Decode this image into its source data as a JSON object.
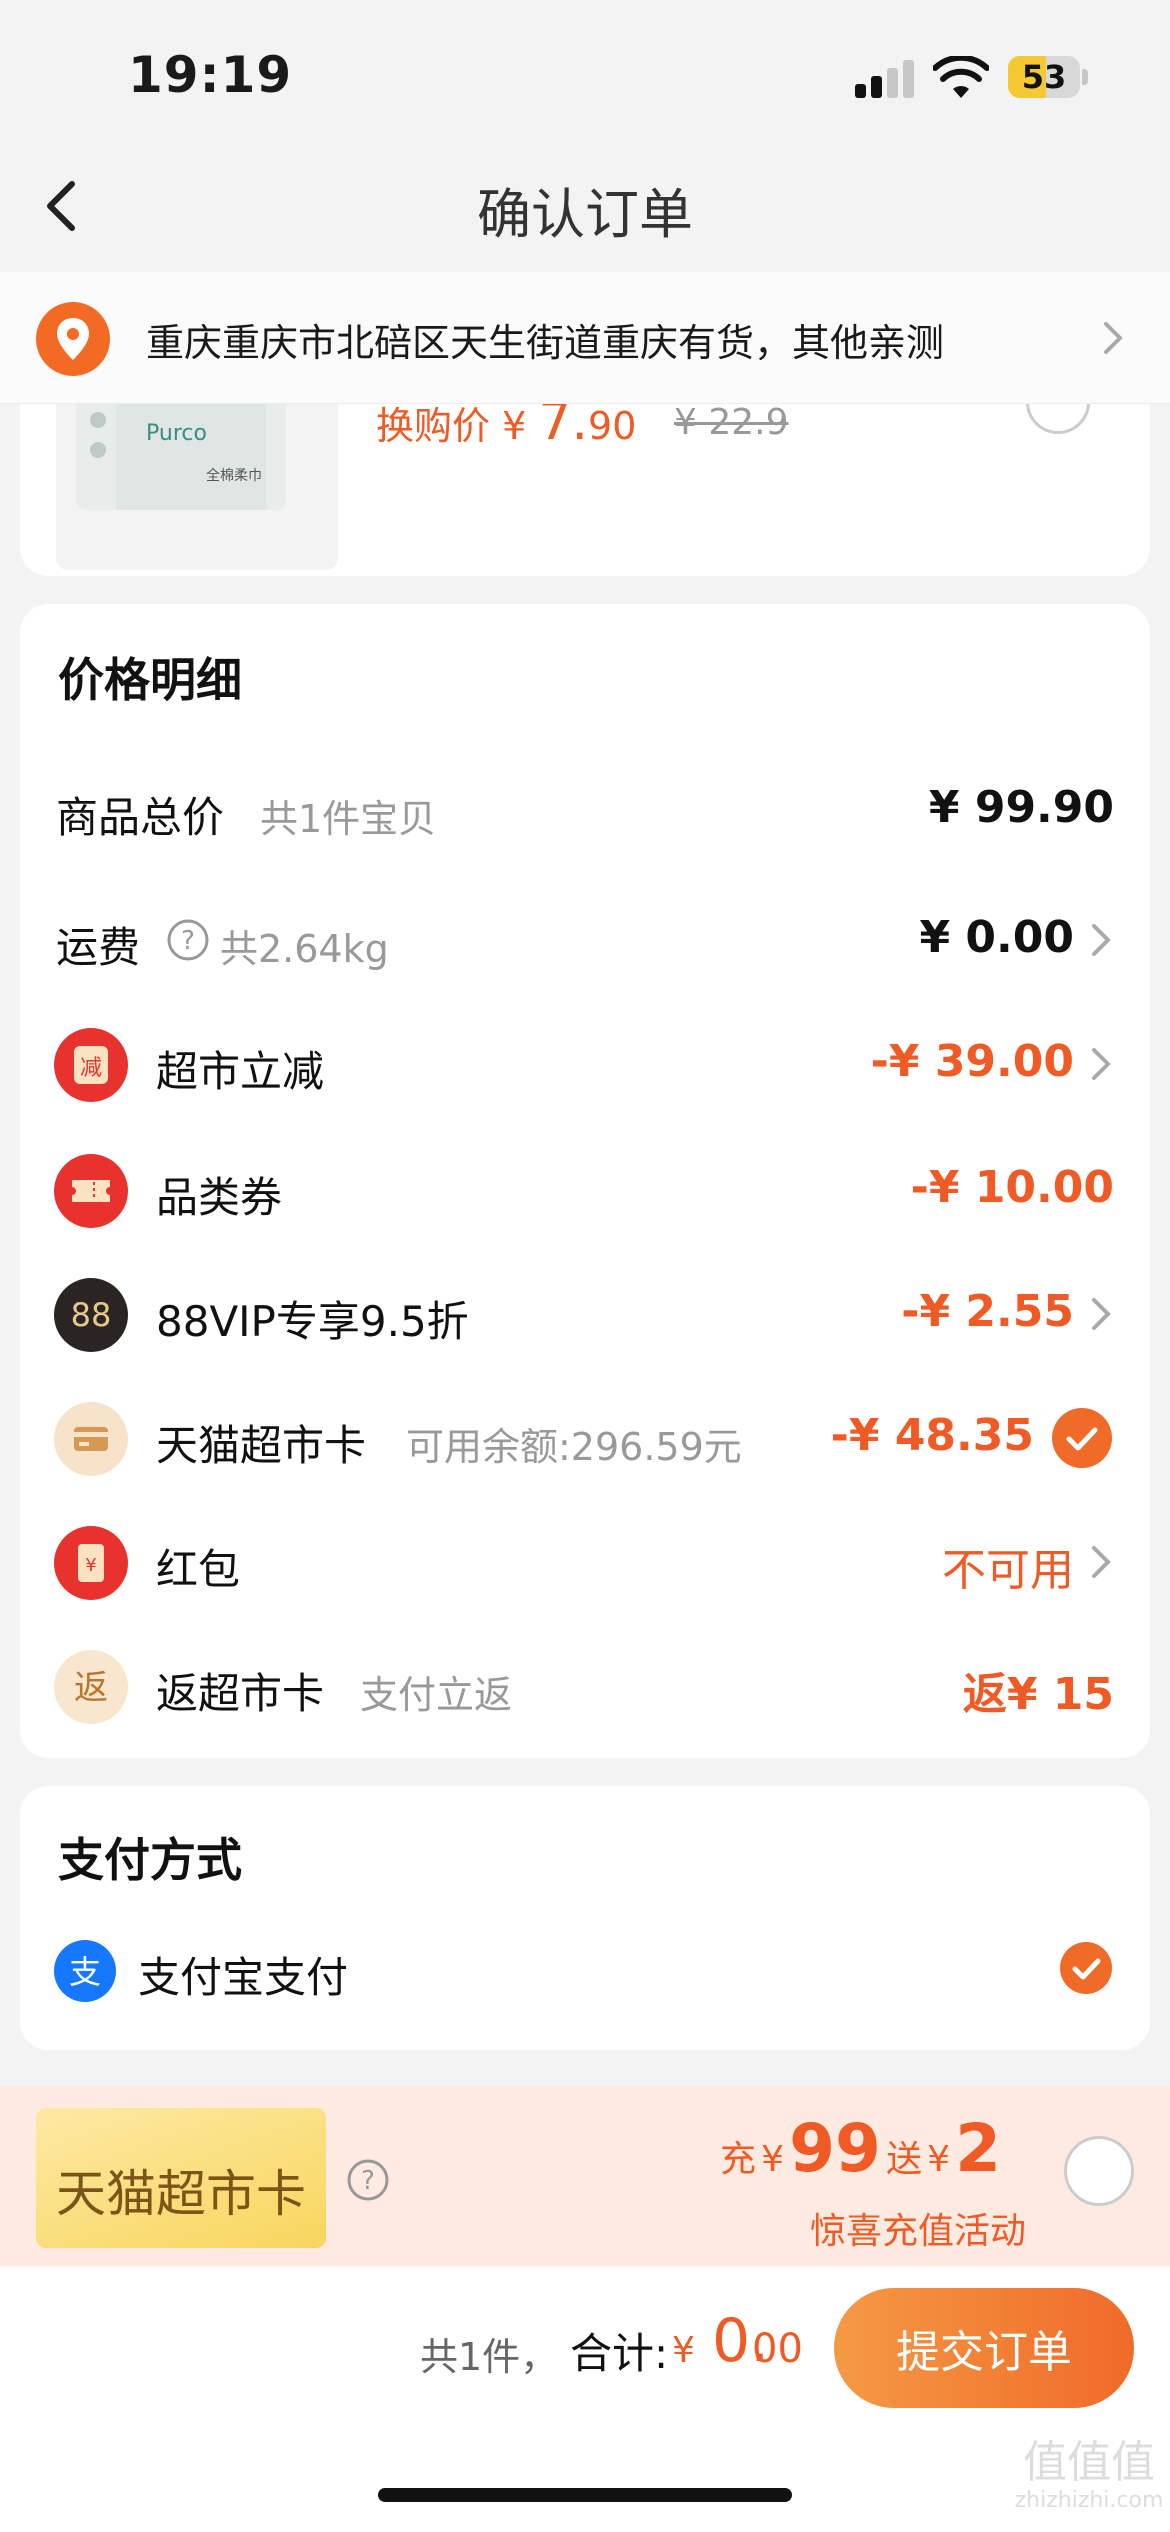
{
  "status_bar": {
    "time": "19:19",
    "battery_level": "53",
    "battery_fraction": 0.53
  },
  "header": {
    "title": "确认订单"
  },
  "address": {
    "text": "重庆重庆市北碚区天生街道重庆有货，其他亲测"
  },
  "product": {
    "price_label": "换购价",
    "price_currency": "¥",
    "price_int": "7.",
    "price_dec": "90",
    "original_price": "¥ 22.9",
    "image_text": "全棉柔巾"
  },
  "price_detail": {
    "title": "价格明细",
    "rows": [
      {
        "label": "商品总价",
        "sub": "共1件宝贝",
        "value": "¥ 99.90"
      },
      {
        "label": "运费",
        "sub": "共2.64kg",
        "value": "¥ 0.00"
      },
      {
        "label": "超市立减",
        "sub": "",
        "value": "-¥ 39.00",
        "icon_text": "减"
      },
      {
        "label": "品类券",
        "sub": "",
        "value": "-¥ 10.00"
      },
      {
        "label": "88VIP专享9.5折",
        "sub": "",
        "value": "-¥ 2.55",
        "icon_text": "88"
      },
      {
        "label": "天猫超市卡",
        "sub": "可用余额:296.59元",
        "value": "-¥ 48.35"
      },
      {
        "label": "红包",
        "sub": "",
        "value": "不可用",
        "icon_text": "¥"
      },
      {
        "label": "返超市卡",
        "sub": "支付立返",
        "value": "返¥ 15",
        "icon_text": "返"
      }
    ]
  },
  "payment": {
    "title": "支付方式",
    "method": "支付宝支付",
    "icon_text": "支"
  },
  "promo": {
    "badge": "天猫超市卡",
    "charge_label": "充",
    "charge_currency": "¥",
    "charge_amount": "99",
    "gift_label": "送",
    "gift_currency": "¥",
    "gift_amount": "2",
    "note": "惊喜充值活动"
  },
  "bottom": {
    "count_text": "共1件，",
    "total_label": "合计:",
    "total_currency": "¥",
    "total_int": "0.",
    "total_dec": "00",
    "submit_label": "提交订单"
  },
  "watermark": {
    "line1": "值值值",
    "line2": "zhizhizhi.com"
  },
  "colors": {
    "accent": "#f05a24",
    "background": "#f3f3f3",
    "card": "#ffffff",
    "promo_bg": "#fdebe2"
  }
}
